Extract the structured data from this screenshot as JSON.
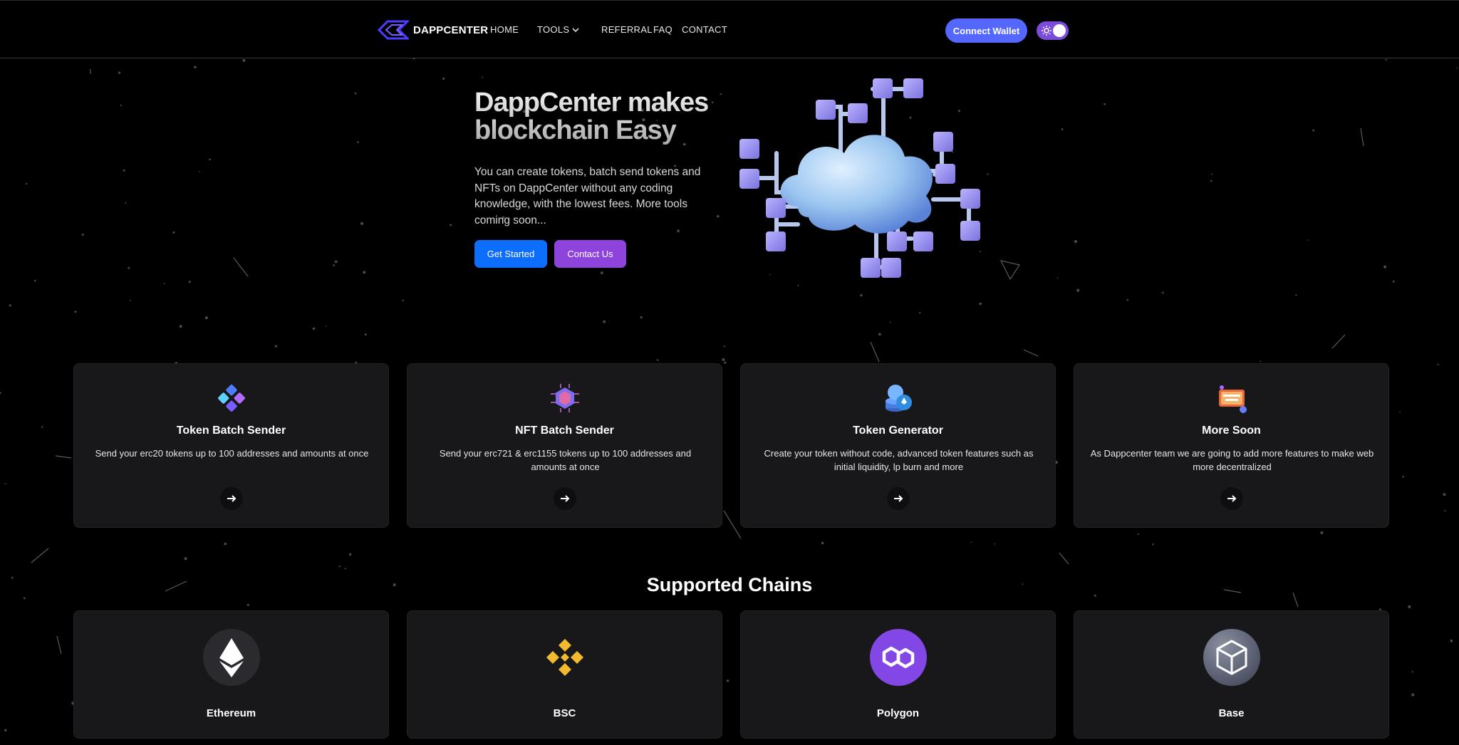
{
  "nav": {
    "brand": "DAPPCENTER",
    "links": {
      "home": "HOME",
      "tools": "TOOLS",
      "referral": "REFERRAL",
      "faq": "FAQ",
      "contact": "CONTACT"
    },
    "connect_wallet": "Connect Wallet",
    "theme_toggle_icon": "sun-icon"
  },
  "hero": {
    "title_line1": "DappCenter makes",
    "title_line2": "blockchain Easy",
    "description": "You can create tokens, batch send tokens and NFTs on DappCenter without any coding knowledge, with the lowest fees. More tools coming soon...",
    "get_started": "Get Started",
    "contact_us": "Contact Us",
    "illustration": "cloud-network-illustration"
  },
  "features": [
    {
      "title": "Token Batch Sender",
      "description": "Send your erc20 tokens up to 100 addresses and amounts at once",
      "icon": "token-cubes-icon"
    },
    {
      "title": "NFT Batch Sender",
      "description": "Send your erc721 & erc1155 tokens up to 100 addresses and amounts at once",
      "icon": "nft-chip-icon"
    },
    {
      "title": "Token Generator",
      "description": "Create your token without code, advanced token features such as initial liquidity, lp burn and more",
      "icon": "coin-stack-icon"
    },
    {
      "title": "More Soon",
      "description": "As Dappcenter team we are going to add more features to make web more decentralized",
      "icon": "coming-soon-icon"
    }
  ],
  "chains": {
    "title": "Supported Chains",
    "items": [
      {
        "name": "Ethereum",
        "icon": "ethereum-icon",
        "color": "#2b2b2f"
      },
      {
        "name": "BSC",
        "icon": "bnb-icon",
        "color": "#f3ba2f"
      },
      {
        "name": "Polygon",
        "icon": "polygon-icon",
        "color": "#8247e5"
      },
      {
        "name": "Base",
        "icon": "base-cube-icon",
        "color": "#5b6172"
      }
    ]
  },
  "colors": {
    "primary": "#0d6efd",
    "purple": "#8e44dc",
    "wallet": "#5468ff",
    "card": "#18181b"
  }
}
